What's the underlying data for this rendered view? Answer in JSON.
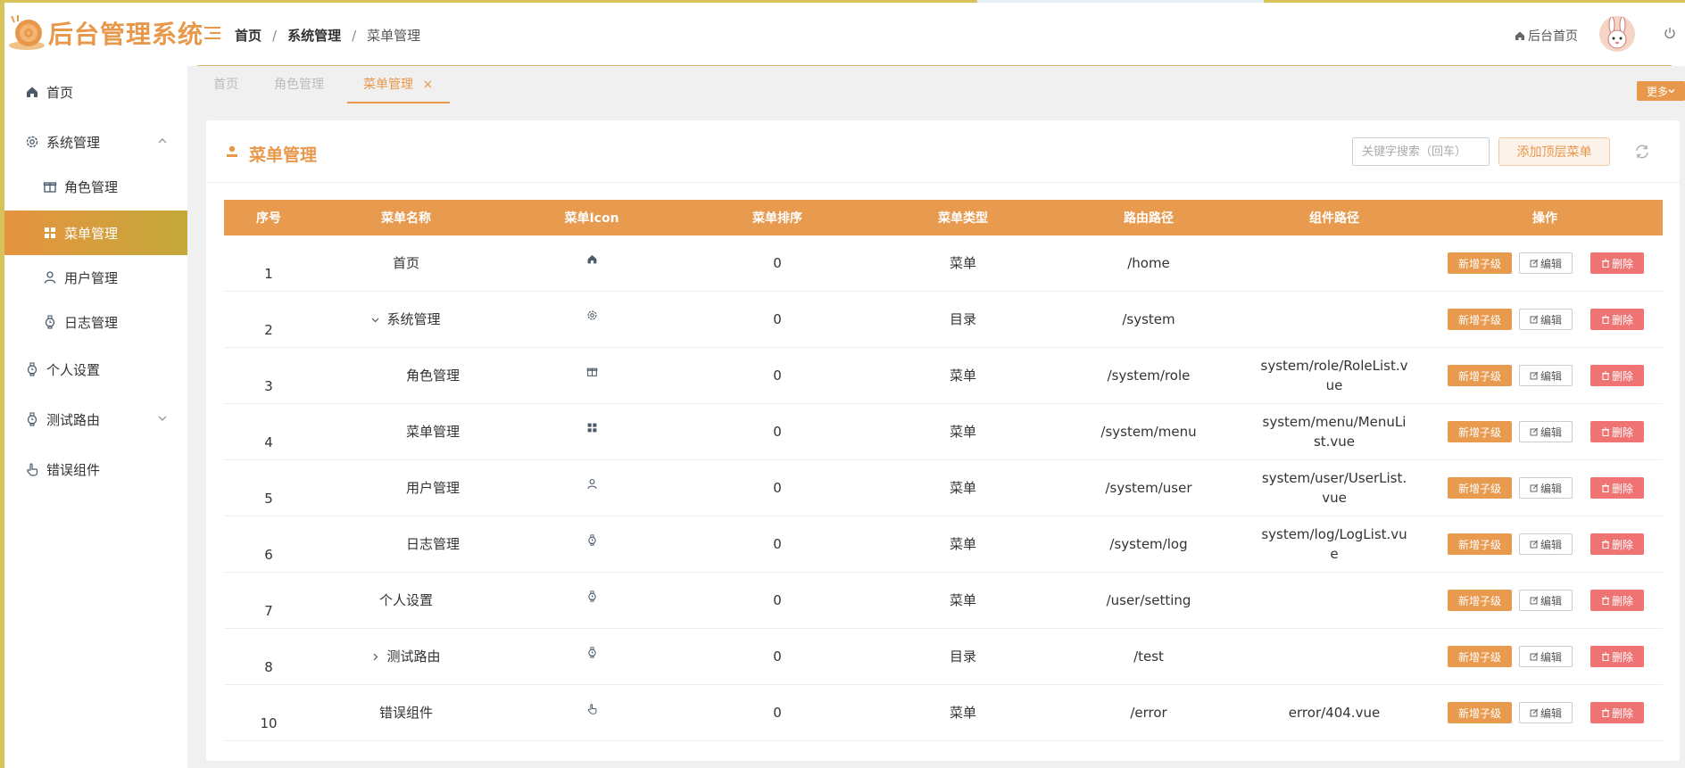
{
  "app": {
    "title": "后台管理系统"
  },
  "header": {
    "breadcrumb": [
      "首页",
      "系统管理",
      "菜单管理"
    ],
    "home_link": "后台首页"
  },
  "sidebar": {
    "items": [
      {
        "label": "首页",
        "icon": "home-icon"
      },
      {
        "label": "系统管理",
        "icon": "gear-icon"
      },
      {
        "label": "角色管理",
        "icon": "gift-icon"
      },
      {
        "label": "菜单管理",
        "icon": "grid-icon"
      },
      {
        "label": "用户管理",
        "icon": "user-icon"
      },
      {
        "label": "日志管理",
        "icon": "watch-icon"
      },
      {
        "label": "个人设置",
        "icon": "watch-icon"
      },
      {
        "label": "测试路由",
        "icon": "watch-icon"
      },
      {
        "label": "错误组件",
        "icon": "pointer-icon"
      }
    ]
  },
  "tabs": [
    {
      "label": "首页"
    },
    {
      "label": "角色管理"
    },
    {
      "label": "菜单管理",
      "close": "×"
    }
  ],
  "more_label": "更多",
  "card": {
    "title": "菜单管理",
    "search_placeholder": "关键字搜索（回车）",
    "add_top_label": "添加顶层菜单"
  },
  "table": {
    "headers": [
      "序号",
      "菜单名称",
      "菜单Icon",
      "菜单排序",
      "菜单类型",
      "路由路径",
      "组件路径",
      "操作"
    ],
    "actions": {
      "add": "新增子级",
      "edit": "编辑",
      "delete": "删除"
    },
    "rows": [
      {
        "index": "1",
        "name": "首页",
        "icon": "home-icon",
        "order": "0",
        "type": "菜单",
        "path": "/home",
        "component": ""
      },
      {
        "index": "2",
        "name": "系统管理",
        "icon": "gear-icon",
        "order": "0",
        "type": "目录",
        "path": "/system",
        "component": ""
      },
      {
        "index": "3",
        "name": "角色管理",
        "icon": "gift-icon",
        "order": "0",
        "type": "菜单",
        "path": "/system/role",
        "component": "system/role/RoleList.vue"
      },
      {
        "index": "4",
        "name": "菜单管理",
        "icon": "grid-icon",
        "order": "0",
        "type": "菜单",
        "path": "/system/menu",
        "component": "system/menu/MenuList.vue"
      },
      {
        "index": "5",
        "name": "用户管理",
        "icon": "user-icon",
        "order": "0",
        "type": "菜单",
        "path": "/system/user",
        "component": "system/user/UserList.vue"
      },
      {
        "index": "6",
        "name": "日志管理",
        "icon": "watch-icon",
        "order": "0",
        "type": "菜单",
        "path": "/system/log",
        "component": "system/log/LogList.vue"
      },
      {
        "index": "7",
        "name": "个人设置",
        "icon": "watch-icon",
        "order": "0",
        "type": "菜单",
        "path": "/user/setting",
        "component": ""
      },
      {
        "index": "8",
        "name": "测试路由",
        "icon": "watch-icon",
        "order": "0",
        "type": "目录",
        "path": "/test",
        "component": ""
      },
      {
        "index": "10",
        "name": "错误组件",
        "icon": "pointer-icon",
        "order": "0",
        "type": "菜单",
        "path": "/error",
        "component": "error/404.vue"
      }
    ]
  },
  "colors": {
    "accent": "#e8984b",
    "danger": "#f07373",
    "active_gradient_end": "#c4a83a"
  }
}
